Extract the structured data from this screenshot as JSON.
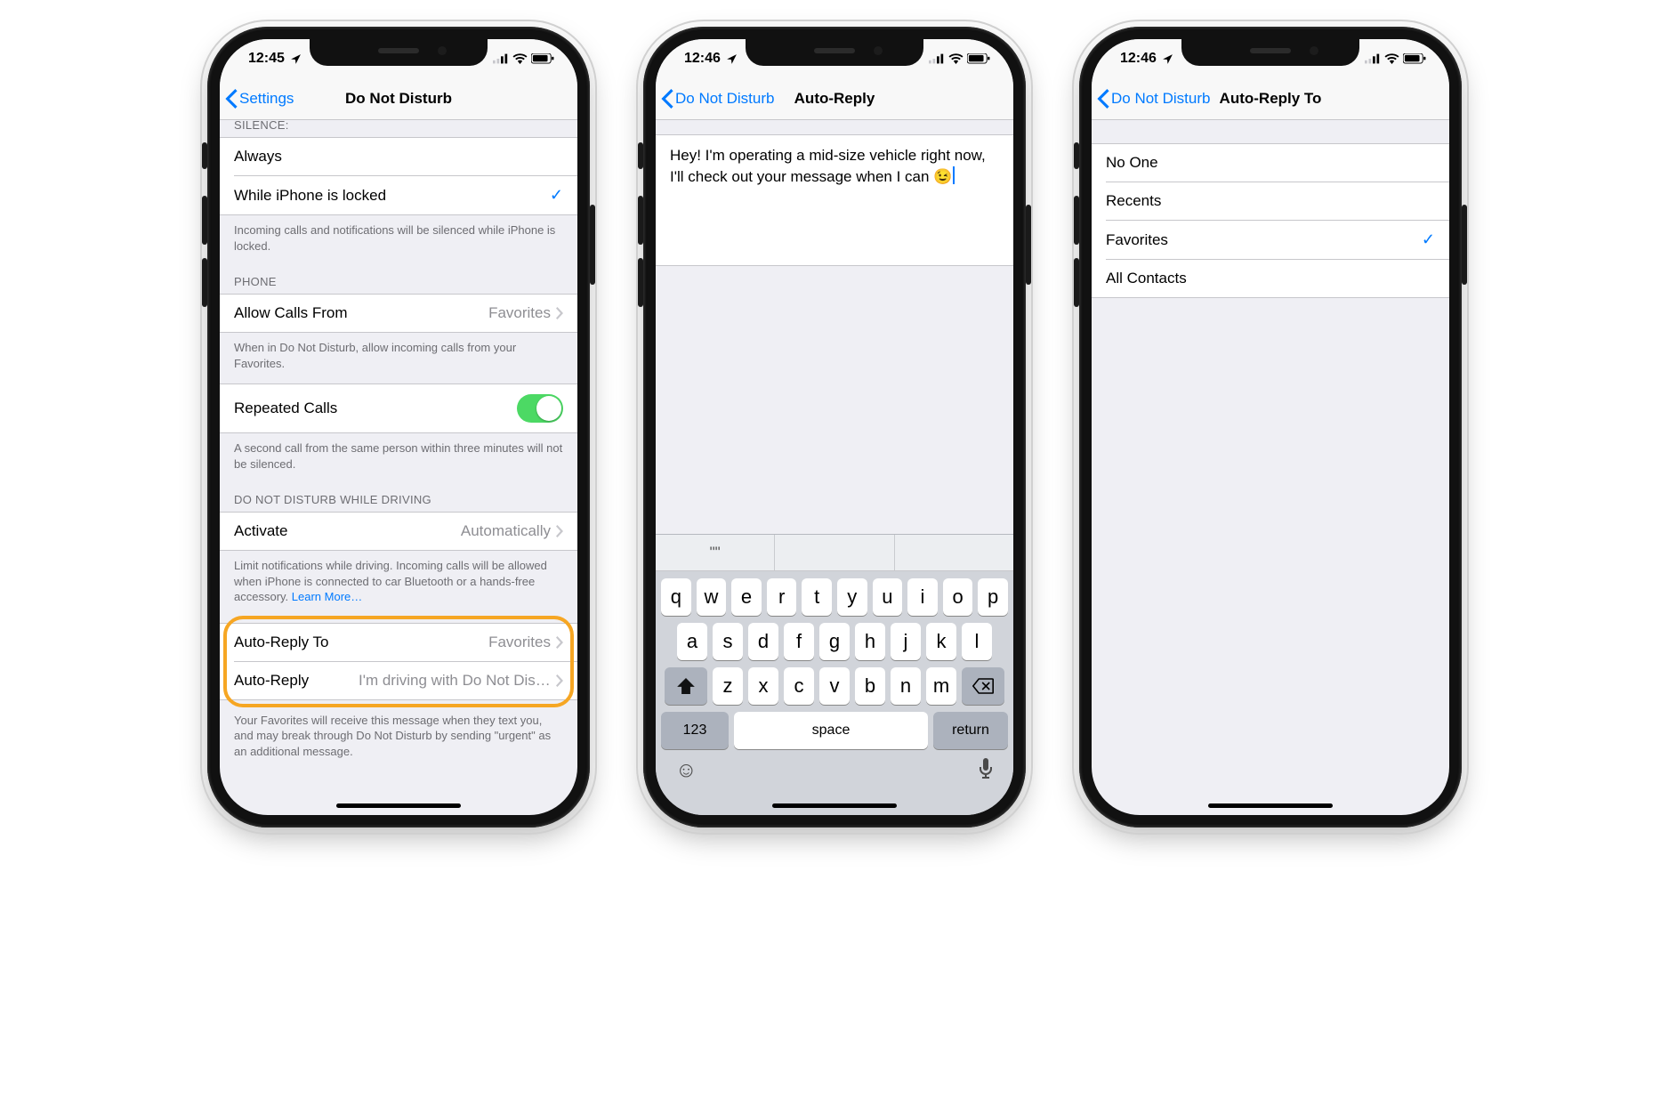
{
  "phone1": {
    "status": {
      "time": "12:45",
      "loc_icon": "location-arrow"
    },
    "nav": {
      "back": "Settings",
      "title": "Do Not Disturb"
    },
    "silence": {
      "header": "SILENCE:",
      "always": "Always",
      "locked": "While iPhone is locked",
      "footer": "Incoming calls and notifications will be silenced while iPhone is locked."
    },
    "phone": {
      "header": "PHONE",
      "allow_label": "Allow Calls From",
      "allow_value": "Favorites",
      "allow_footer": "When in Do Not Disturb, allow incoming calls from your Favorites.",
      "repeated_label": "Repeated Calls",
      "repeated_on": true,
      "repeated_footer": "A second call from the same person within three minutes will not be silenced."
    },
    "driving": {
      "header": "DO NOT DISTURB WHILE DRIVING",
      "activate_label": "Activate",
      "activate_value": "Automatically",
      "activate_footer_a": "Limit notifications while driving. Incoming calls will be allowed when iPhone is connected to car Bluetooth or a hands-free accessory. ",
      "activate_footer_link": "Learn More…",
      "reply_to_label": "Auto-Reply To",
      "reply_to_value": "Favorites",
      "reply_label": "Auto-Reply",
      "reply_value": "I'm driving with Do Not Disturb While Driving turned on.",
      "reply_footer": "Your Favorites will receive this message when they text you, and may break through Do Not Disturb by sending \"urgent\" as an additional message."
    }
  },
  "phone2": {
    "status": {
      "time": "12:46"
    },
    "nav": {
      "back": "Do Not Disturb",
      "title": "Auto-Reply"
    },
    "message": "Hey! I'm operating a mid-size vehicle right now, I'll check out your message when I can 😉",
    "predictions": [
      "\"\"",
      "",
      ""
    ],
    "keys": {
      "r1": [
        "q",
        "w",
        "e",
        "r",
        "t",
        "y",
        "u",
        "i",
        "o",
        "p"
      ],
      "r2": [
        "a",
        "s",
        "d",
        "f",
        "g",
        "h",
        "j",
        "k",
        "l"
      ],
      "r3": [
        "z",
        "x",
        "c",
        "v",
        "b",
        "n",
        "m"
      ],
      "num": "123",
      "space": "space",
      "return": "return"
    }
  },
  "phone3": {
    "status": {
      "time": "12:46"
    },
    "nav": {
      "back": "Do Not Disturb",
      "title": "Auto-Reply To"
    },
    "options": [
      {
        "label": "No One",
        "selected": false
      },
      {
        "label": "Recents",
        "selected": false
      },
      {
        "label": "Favorites",
        "selected": true
      },
      {
        "label": "All Contacts",
        "selected": false
      }
    ]
  }
}
